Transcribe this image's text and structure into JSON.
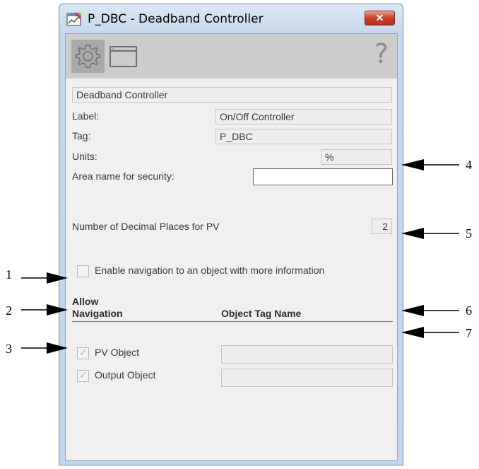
{
  "window": {
    "title": "P_DBC - Deadband Controller",
    "close_symbol": "✕"
  },
  "toolbar": {
    "tabs": [
      {
        "name": "configuration-tab",
        "icon": "gear-icon",
        "selected": true
      },
      {
        "name": "window-tab",
        "icon": "window-icon",
        "selected": false
      }
    ],
    "help_symbol": "?"
  },
  "config": {
    "description_value": "Deadband Controller",
    "label_caption": "Label:",
    "label_value": "On/Off Controller",
    "tag_caption": "Tag:",
    "tag_value": "P_DBC",
    "units_caption": "Units:",
    "units_value": "%",
    "area_caption": "Area name for security:",
    "area_value": "",
    "decimal_caption": "Number of Decimal Places for PV",
    "decimal_value": "2"
  },
  "navigation": {
    "enable_label": "Enable navigation to an object with more information",
    "enable_checked": false,
    "col_allow_line1": "Allow",
    "col_allow_line2": "Navigation",
    "col_tag": "Object Tag Name",
    "rows": [
      {
        "label": "PV Object",
        "checked": true,
        "value": ""
      },
      {
        "label": "Output Object",
        "checked": true,
        "value": ""
      }
    ]
  },
  "callouts": [
    "1",
    "2",
    "3",
    "4",
    "5",
    "6",
    "7"
  ]
}
